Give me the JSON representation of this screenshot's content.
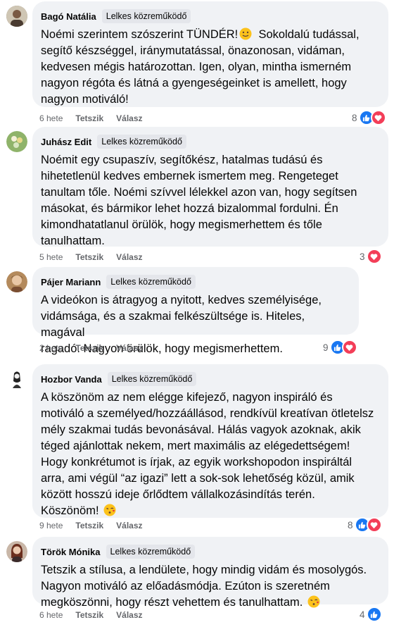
{
  "badge_label": "Lelkes közreműködő",
  "actions": {
    "like": "Tetszik",
    "reply": "Válasz"
  },
  "colors": {
    "like": "#1877f2",
    "love": "#f33e58",
    "bubble": "#f0f2f5"
  },
  "comments": [
    {
      "author": "Bagó Natália",
      "time": "6 hete",
      "reaction_count": "8",
      "reactions": [
        "like-icon",
        "love-icon"
      ],
      "text_lines": [
        "Noémi szerintem szószerint TÜNDÉR!",
        "segítő készséggel, iránymutatással, önazonosan, vidáman,",
        "kedvesen mégis határozottan. Igen, olyan, mintha ismerném",
        "nagyon régóta és látná a gyengeségeinket is amellett, hogy",
        "nagyon motiváló!"
      ],
      "text_line1_tail": "Sokoldalú tudással,",
      "emoji": "smiling-face-emoji"
    },
    {
      "author": "Juhász Edit",
      "time": "5 hete",
      "reaction_count": "3",
      "reactions": [
        "love-icon"
      ],
      "text_lines": [
        "Noémit egy csupaszív, segítőkész, hatalmas tudású és",
        "hihetetlenül kedves embernek ismertem meg. Rengeteget",
        "tanultam tőle. Noémi szívvel lélekkel azon van, hogy segítsen",
        "másokat, és bármikor lehet hozzá bizalommal fordulni. Én",
        "kimondhatatlanul örülök, hogy megismerhettem és tőle",
        "tanulhattam."
      ]
    },
    {
      "author": "Pájer Mariann",
      "time": "2 hete",
      "reaction_count": "9",
      "reactions": [
        "like-icon",
        "love-icon"
      ],
      "text_lines": [
        "A videókon is átragyog a nyitott, kedves személyisége,",
        "vidámsága, és a szakmai felkészültsége is. Hiteles, magával",
        "ragadó. Nagyon örülök, hogy megismerhettem."
      ]
    },
    {
      "author": "Hozbor Vanda",
      "time": "9 hete",
      "reaction_count": "8",
      "reactions": [
        "like-icon",
        "love-icon"
      ],
      "text_lines": [
        "A köszönöm az nem elégge kifejező, nagyon inspiráló és",
        "motiváló a személyed/hozzáállásod, rendkívül kreatívan ötletelsz",
        "mély szakmai tudás bevonásával. Hálás vagyok azoknak, akik",
        "téged ajánlottak nekem, mert maximális az elégedettségem!",
        "Hogy konkrétumot is írjak, az egyik workshopodon inspiráltál",
        "arra, ami végül “az igazi” lett a sok-sok lehetőség közül, amik",
        "között hosszú ideje őrlődtem vállalkozásindítás terén.",
        "Köszönöm!"
      ],
      "emoji": "kissing-face-emoji"
    },
    {
      "author": "Török Mónika",
      "time": "6 hete",
      "reaction_count": "4",
      "reactions": [
        "like-icon"
      ],
      "text_lines": [
        "Tetszik a stílusa, a lendülete, hogy mindig vidám és mosolygós.",
        "Nagyon motiváló az előadásmódja. Ezúton is szeretném",
        "megköszönni, hogy részt vehettem és tanulhattam."
      ],
      "emoji": "kissing-face-emoji"
    }
  ]
}
